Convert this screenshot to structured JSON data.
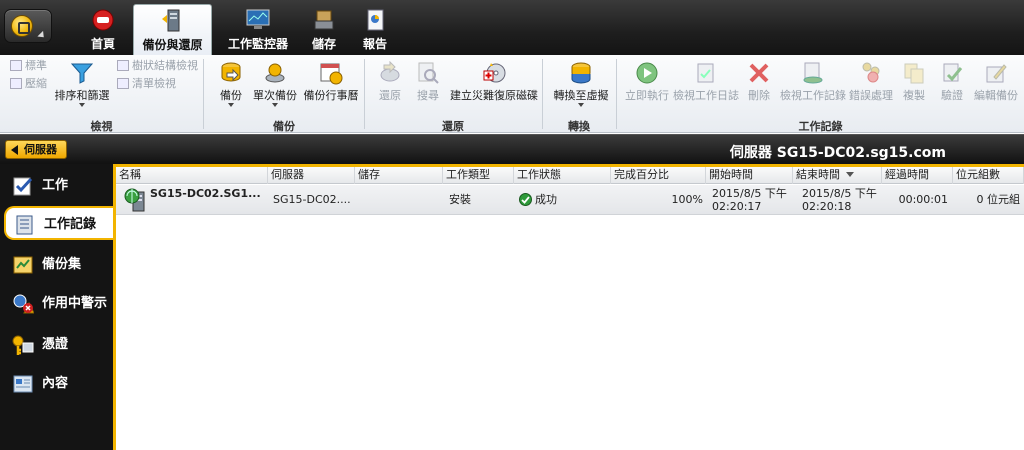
{
  "tabs": [
    {
      "label": "首頁",
      "icon": "home-icon"
    },
    {
      "label": "備份與還原",
      "icon": "backup-restore-icon",
      "active": true
    },
    {
      "label": "工作監控器",
      "icon": "job-monitor-icon"
    },
    {
      "label": "儲存",
      "icon": "storage-icon"
    },
    {
      "label": "報告",
      "icon": "reports-icon"
    }
  ],
  "ribbon": {
    "view": {
      "label": "檢視",
      "standard": "標準",
      "compact": "壓縮",
      "sort_filter": "排序和篩選",
      "tree_view": "樹狀結構檢視",
      "list_view": "清單檢視"
    },
    "backup": {
      "label": "備份",
      "backup": "備份",
      "one_time": "單次備份",
      "calendar": "備份行事曆"
    },
    "restore": {
      "label": "還原",
      "restore": "還原",
      "search": "搜尋",
      "disaster_recovery": "建立災難復原磁碟"
    },
    "convert": {
      "label": "轉換",
      "convert_virtual": "轉換至虛擬"
    },
    "job_history": {
      "label": "工作記錄",
      "run_now": "立即執行",
      "view_job_log": "檢視工作日誌",
      "delete": "刪除",
      "view_job_history": "檢視工作記錄",
      "error_handling": "錯誤處理",
      "copy": "複製",
      "verify": "驗證",
      "edit_backup": "編輯備份"
    }
  },
  "location": {
    "back_label": "伺服器",
    "title": "伺服器 SG15-DC02.sg15.com"
  },
  "sidebar": {
    "items": [
      {
        "label": "工作",
        "icon": "jobs-icon"
      },
      {
        "label": "工作記錄",
        "icon": "job-history-icon",
        "active": true
      },
      {
        "label": "備份集",
        "icon": "backup-sets-icon"
      },
      {
        "label": "作用中警示",
        "icon": "active-alerts-icon"
      },
      {
        "label": "憑證",
        "icon": "credentials-icon"
      },
      {
        "label": "內容",
        "icon": "properties-icon"
      }
    ]
  },
  "table": {
    "columns": [
      "名稱",
      "伺服器",
      "儲存",
      "工作類型",
      "工作狀態",
      "完成百分比",
      "開始時間",
      "結束時間",
      "經過時間",
      "位元組數"
    ],
    "sorted_column": "結束時間",
    "rows": [
      {
        "name": "SG15-DC02.SG1...",
        "server": "SG15-DC02....",
        "storage": "",
        "job_type": "安裝",
        "status": "成功",
        "percent": "100%",
        "start_date": "2015/8/5 下午",
        "start_time": "02:20:17",
        "end_date": "2015/8/5 下午",
        "end_time": "02:20:18",
        "elapsed": "00:00:01",
        "bytes": "0 位元組"
      }
    ]
  },
  "colors": {
    "accent": "#f2b400",
    "topbar": "#1e1e1e",
    "success": "#2e9a3a"
  }
}
